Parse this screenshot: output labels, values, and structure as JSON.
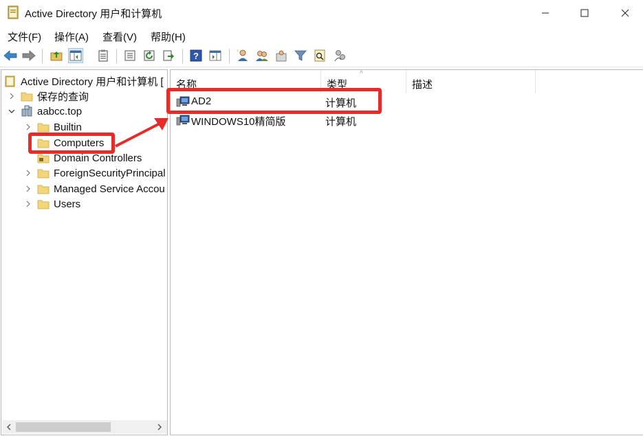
{
  "window": {
    "title": "Active Directory 用户和计算机",
    "buttons": {
      "minimize": "minimize",
      "maximize": "maximize",
      "close": "close"
    }
  },
  "menu": [
    "文件(F)",
    "操作(A)",
    "查看(V)",
    "帮助(H)"
  ],
  "toolbar": {
    "icons": [
      "back-icon",
      "forward-icon",
      "up-folder-icon",
      "show-console-tree-icon",
      "properties-icon",
      "export-list-icon",
      "refresh-icon",
      "export-icon",
      "help-icon",
      "show-action-pane-icon",
      "new-user-icon",
      "new-group-icon",
      "new-ou-icon",
      "filter-icon",
      "find-icon",
      "add-to-group-icon"
    ]
  },
  "tree": {
    "root": "Active Directory 用户和计算机 [",
    "saved_queries": "保存的查询",
    "domain": "aabcc.top",
    "children": [
      "Builtin",
      "Computers",
      "Domain Controllers",
      "ForeignSecurityPrincipal",
      "Managed Service Accou",
      "Users"
    ]
  },
  "list": {
    "columns": {
      "name": "名称",
      "type": "类型",
      "description": "描述"
    },
    "rows": [
      {
        "name": "AD2",
        "type": "计算机"
      },
      {
        "name": "WINDOWS10精简版",
        "type": "计算机"
      }
    ]
  },
  "colors": {
    "annotation": "#e62b2b",
    "folder": "#f3d57b",
    "selection": "#dbe9f7"
  }
}
